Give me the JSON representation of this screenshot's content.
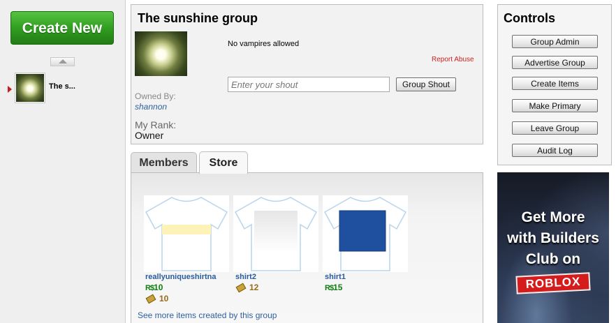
{
  "sidebar": {
    "create_new_label": "Create New",
    "groups": [
      {
        "label": "The s...",
        "selected": true
      }
    ]
  },
  "group": {
    "title": "The sunshine group",
    "description": "No vampires allowed",
    "report_abuse": "Report Abuse",
    "owned_by_label": "Owned By:",
    "owner_name": "shannon",
    "rank_label": "My Rank:",
    "rank_value": "Owner",
    "shout_placeholder": "Enter your shout",
    "shout_button": "Group Shout"
  },
  "tabs": [
    {
      "label": "Members",
      "active": false
    },
    {
      "label": "Store",
      "active": true
    }
  ],
  "store": {
    "items": [
      {
        "name": "reallyuniqueshirtna",
        "robux": "10",
        "tix": "10",
        "shirt_color": "#fdf2b8"
      },
      {
        "name": "shirt2",
        "robux": "",
        "tix": "12",
        "shirt_color": "#f0f0f0"
      },
      {
        "name": "shirt1",
        "robux": "15",
        "tix": "",
        "shirt_color": "#1f4f9f"
      }
    ],
    "see_more": "See more items created by this group"
  },
  "controls": {
    "title": "Controls",
    "buttons": [
      "Group Admin",
      "Advertise Group",
      "Create Items",
      "Make Primary",
      "Leave Group",
      "Audit Log"
    ]
  },
  "ad": {
    "lines": [
      "Get More",
      "with Builders",
      "Club on"
    ],
    "logo_text": "ROBLOX"
  },
  "colors": {
    "accent_green": "#2f9b1f",
    "link_blue": "#2f5f9e",
    "report_red": "#cc2222",
    "robux_green": "#0f7f0f",
    "tix_brown": "#9a6a1c"
  }
}
